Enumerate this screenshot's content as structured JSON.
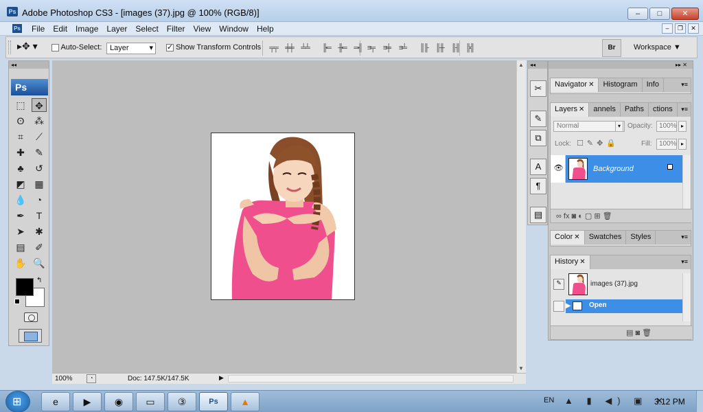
{
  "window": {
    "title": "Adobe Photoshop CS3 - [images (37).jpg @ 100% (RGB/8)]",
    "app_icon": "Ps",
    "controls": {
      "minimize": "–",
      "maximize": "□",
      "close": "✕"
    }
  },
  "menu": {
    "items": [
      "File",
      "Edit",
      "Image",
      "Layer",
      "Select",
      "Filter",
      "View",
      "Window",
      "Help"
    ],
    "doc_controls": {
      "minimize": "–",
      "restore": "❐",
      "close": "✕"
    }
  },
  "options_bar": {
    "tool_preset": "▸✥ ▾",
    "auto_select_label": "Auto-Select:",
    "auto_select_checked": false,
    "auto_select_value": "Layer",
    "show_transform_label": "Show Transform Controls",
    "show_transform_checked": true,
    "bridge_label": "Br",
    "workspace_label": "Workspace ▼"
  },
  "tools_panel": {
    "logo": "Ps",
    "collapse": "◂◂",
    "tools": [
      {
        "name": "marquee-tool-icon",
        "glyph": "⬚"
      },
      {
        "name": "move-tool-icon",
        "glyph": "✥"
      },
      {
        "name": "lasso-tool-icon",
        "glyph": "ʘ"
      },
      {
        "name": "magic-wand-tool-icon",
        "glyph": "⁂"
      },
      {
        "name": "crop-tool-icon",
        "glyph": "⌗"
      },
      {
        "name": "slice-tool-icon",
        "glyph": "⟋"
      },
      {
        "name": "healing-brush-tool-icon",
        "glyph": "✚"
      },
      {
        "name": "brush-tool-icon",
        "glyph": "✎"
      },
      {
        "name": "clone-stamp-tool-icon",
        "glyph": "♣"
      },
      {
        "name": "history-brush-tool-icon",
        "glyph": "↺"
      },
      {
        "name": "eraser-tool-icon",
        "glyph": "◩"
      },
      {
        "name": "gradient-tool-icon",
        "glyph": "▦"
      },
      {
        "name": "blur-tool-icon",
        "glyph": "💧"
      },
      {
        "name": "dodge-tool-icon",
        "glyph": "◔"
      },
      {
        "name": "pen-tool-icon",
        "glyph": "✒"
      },
      {
        "name": "type-tool-icon",
        "glyph": "T"
      },
      {
        "name": "path-selection-tool-icon",
        "glyph": "➤"
      },
      {
        "name": "shape-tool-icon",
        "glyph": "✱"
      },
      {
        "name": "notes-tool-icon",
        "glyph": "▤"
      },
      {
        "name": "eyedropper-tool-icon",
        "glyph": "✐"
      },
      {
        "name": "hand-tool-icon",
        "glyph": "✋"
      },
      {
        "name": "zoom-tool-icon",
        "glyph": "🔍"
      }
    ],
    "foreground_color": "#000000",
    "background_color": "#ffffff"
  },
  "document": {
    "zoom": "100%",
    "doc_size": "Doc: 147.5K/147.5K",
    "canvas_color": "#bdbdbd"
  },
  "icon_dock": {
    "collapse": "◂◂",
    "buttons": [
      {
        "name": "tool-presets-icon",
        "glyph": "✂"
      },
      {
        "name": "brushes-icon",
        "glyph": "✎"
      },
      {
        "name": "clone-source-icon",
        "glyph": "⧉"
      },
      {
        "name": "character-icon",
        "glyph": "A"
      },
      {
        "name": "paragraph-icon",
        "glyph": "¶"
      },
      {
        "name": "layer-comps-icon",
        "glyph": "▤"
      }
    ]
  },
  "panels": {
    "header_controls": "▸▸ ✕",
    "group1_tabs": [
      {
        "label": "Navigator",
        "close": "✕"
      },
      {
        "label": "Histogram",
        "close": ""
      },
      {
        "label": "Info",
        "close": ""
      }
    ],
    "group2_tabs": [
      {
        "label": "Layers",
        "close": "✕"
      },
      {
        "label": "annels",
        "close": ""
      },
      {
        "label": "Paths",
        "close": ""
      },
      {
        "label": "ctions",
        "close": ""
      }
    ],
    "layers": {
      "blend_mode": "Normal",
      "opacity_label": "Opacity:",
      "opacity_value": "100%",
      "lock_label": "Lock:",
      "lock_icons": "☐✎✥🔒",
      "fill_label": "Fill:",
      "fill_value": "100%",
      "layer_name": "Background",
      "footer_icons": "∞ fx ◙ ◐ ▢ ⊞ 🗑"
    },
    "group3_tabs": [
      {
        "label": "Color",
        "close": "✕"
      },
      {
        "label": "Swatches",
        "close": ""
      },
      {
        "label": "Styles",
        "close": ""
      }
    ],
    "group4_tabs": [
      {
        "label": "History",
        "close": "✕"
      }
    ],
    "history": {
      "snapshot_name": "images (37).jpg",
      "step_name": "Open",
      "footer_icons": "▤ ◙ 🗑"
    },
    "menu_glyph": "▾≡"
  },
  "taskbar": {
    "buttons": [
      {
        "name": "internet-explorer-icon",
        "glyph": "e",
        "active": false
      },
      {
        "name": "media-player-icon",
        "glyph": "▶",
        "active": false
      },
      {
        "name": "chrome-icon",
        "glyph": "◉",
        "active": false
      },
      {
        "name": "file-explorer-icon",
        "glyph": "▭",
        "active": false
      },
      {
        "name": "app-3-icon",
        "glyph": "③",
        "active": false
      },
      {
        "name": "photoshop-icon",
        "glyph": "Ps",
        "active": true
      },
      {
        "name": "vlc-icon",
        "glyph": "▲",
        "active": false
      }
    ],
    "language": "EN",
    "tray_icons": "▲ ▮ ◀) ▣ ✕",
    "time": "3:12 PM"
  }
}
